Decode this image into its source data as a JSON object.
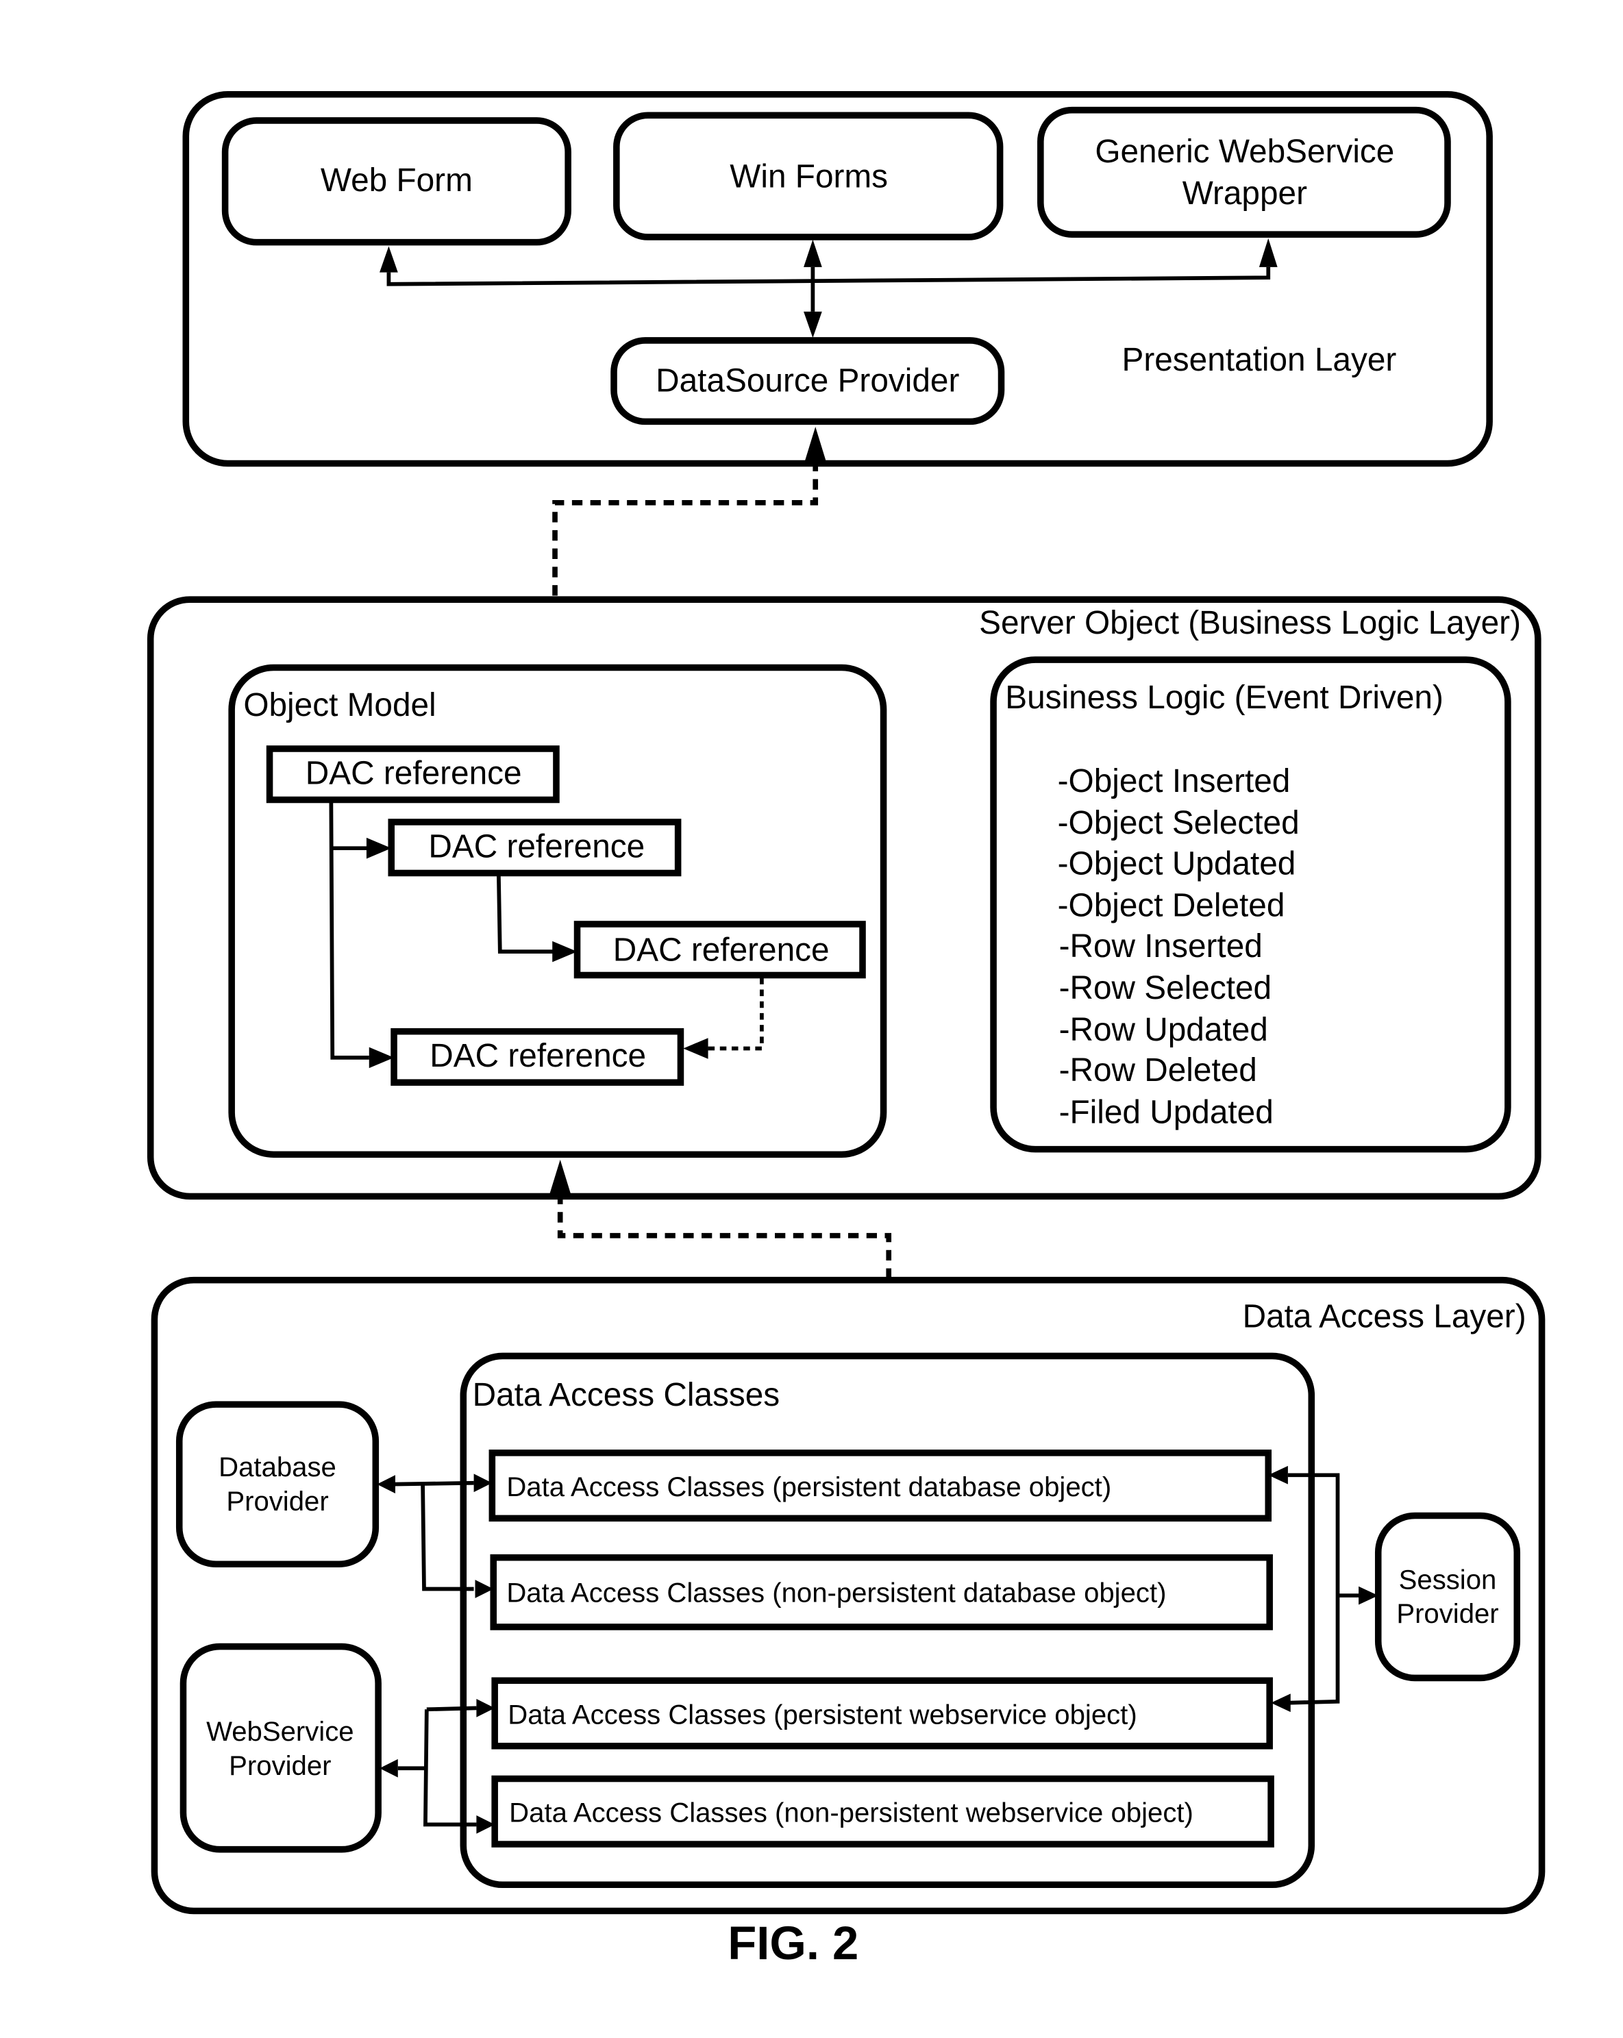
{
  "presentation_layer": {
    "label": "Presentation Layer",
    "web_form": "Web Form",
    "win_forms": "Win Forms",
    "webservice_wrapper_line1": "Generic WebService",
    "webservice_wrapper_line2": "Wrapper",
    "datasource_provider": "DataSource Provider"
  },
  "business_logic_layer": {
    "label": "Server Object (Business Logic Layer)",
    "object_model": {
      "title": "Object Model",
      "dac_refs": [
        "DAC reference",
        "DAC reference",
        "DAC reference",
        "DAC reference"
      ]
    },
    "business_logic": {
      "title": "Business Logic (Event Driven)",
      "events": [
        "-Object Inserted",
        "-Object Selected",
        "-Object Updated",
        "-Object Deleted",
        "-Row Inserted",
        "-Row Selected",
        "-Row Updated",
        "-Row Deleted",
        "-Filed Updated"
      ]
    }
  },
  "data_access_layer": {
    "label": "Data Access Layer)",
    "database_provider_line1": "Database",
    "database_provider_line2": "Provider",
    "webservice_provider_line1": "WebService",
    "webservice_provider_line2": "Provider",
    "session_provider_line1": "Session",
    "session_provider_line2": "Provider",
    "classes": {
      "title": "Data Access Classes",
      "items": [
        "Data Access Classes (persistent database object)",
        "Data Access Classes (non-persistent database object)",
        "Data Access Classes (persistent webservice object)",
        "Data Access Classes (non-persistent webservice object)"
      ]
    }
  },
  "caption": "FIG. 2"
}
